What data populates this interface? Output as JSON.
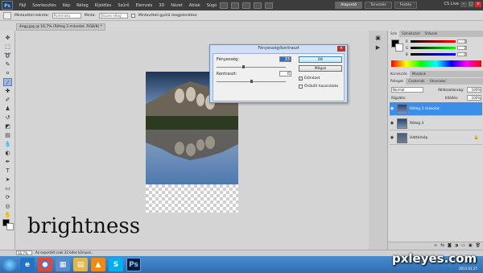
{
  "menubar": {
    "logo": "Ps",
    "items": [
      "Fájl",
      "Szerkesztés",
      "Kép",
      "Réteg",
      "Kijelölés",
      "Szűrő",
      "Elemzés",
      "3D",
      "Nézet",
      "Ablak",
      "Súgó"
    ],
    "workspaces": [
      "Alapvető",
      "Tervezés",
      "Festés"
    ],
    "cs_live": "CS Live"
  },
  "options": {
    "sample_size_label": "Mintavétel mérete:",
    "sample_size_value": "Pontminta",
    "sample_label": "Minta:",
    "sample_value": "Összes réteg",
    "show_ring_label": "Mintavételi gyűrű megjelenítése"
  },
  "document": {
    "tab_title": "4egy.jpg @ 16,7% (Réteg 3 másolat, RGB/8) *"
  },
  "dialog": {
    "title": "Fényesség/kontraszt",
    "brightness_label": "Fényesség:",
    "brightness_value": "33",
    "contrast_label": "Kontraszt:",
    "contrast_value": "0",
    "ok_label": "OK",
    "cancel_label": "Mégse",
    "preview_label": "Előnézet",
    "legacy_label": "Örökölt használata",
    "brightness_level": 0.39,
    "contrast_level": 0.5
  },
  "overlay_text": "brightness",
  "status": {
    "zoom": "16,7%",
    "message": "Az exportált csak 32 bites környez..."
  },
  "panels": {
    "color_tabs": [
      "Szín",
      "Színkészlet",
      "Stílusok"
    ],
    "color_rows": [
      {
        "label": "R",
        "value": "0"
      },
      {
        "label": "G",
        "value": "0"
      },
      {
        "label": "B",
        "value": "0"
      }
    ],
    "adjust_tabs": [
      "Korrekciók",
      "Maszkok"
    ],
    "layer_tabs": [
      "Rétegek",
      "Csatornák",
      "Útvonalak"
    ],
    "blend_mode": "Normál",
    "opacity_label": "Átlátszatlanság:",
    "opacity_value": "100%",
    "lock_label": "Rögzítés:",
    "fill_label": "Kitöltés:",
    "fill_value": "100%",
    "layers": [
      {
        "name": "Réteg 3 másolat",
        "selected": true
      },
      {
        "name": "Réteg 3",
        "selected": false
      },
      {
        "name": "Háttérkép",
        "selected": false
      }
    ]
  },
  "taskbar": {
    "apps": [
      "start-button",
      "ie-icon",
      "chrome-icon",
      "explorer-icon",
      "folder-icon",
      "vlc-icon",
      "skype-icon",
      "photoshop-icon"
    ],
    "labels": [
      "",
      "e",
      "◉",
      "▦",
      "▤",
      "▲",
      "S",
      "Ps"
    ]
  },
  "watermark": {
    "text": "pxleyes.com",
    "date": "2013.01.27."
  },
  "colors": {
    "accent_blue": "#3d8ee8",
    "dialog_border": "#6a8fc4",
    "taskbar": "#2f6db0"
  }
}
